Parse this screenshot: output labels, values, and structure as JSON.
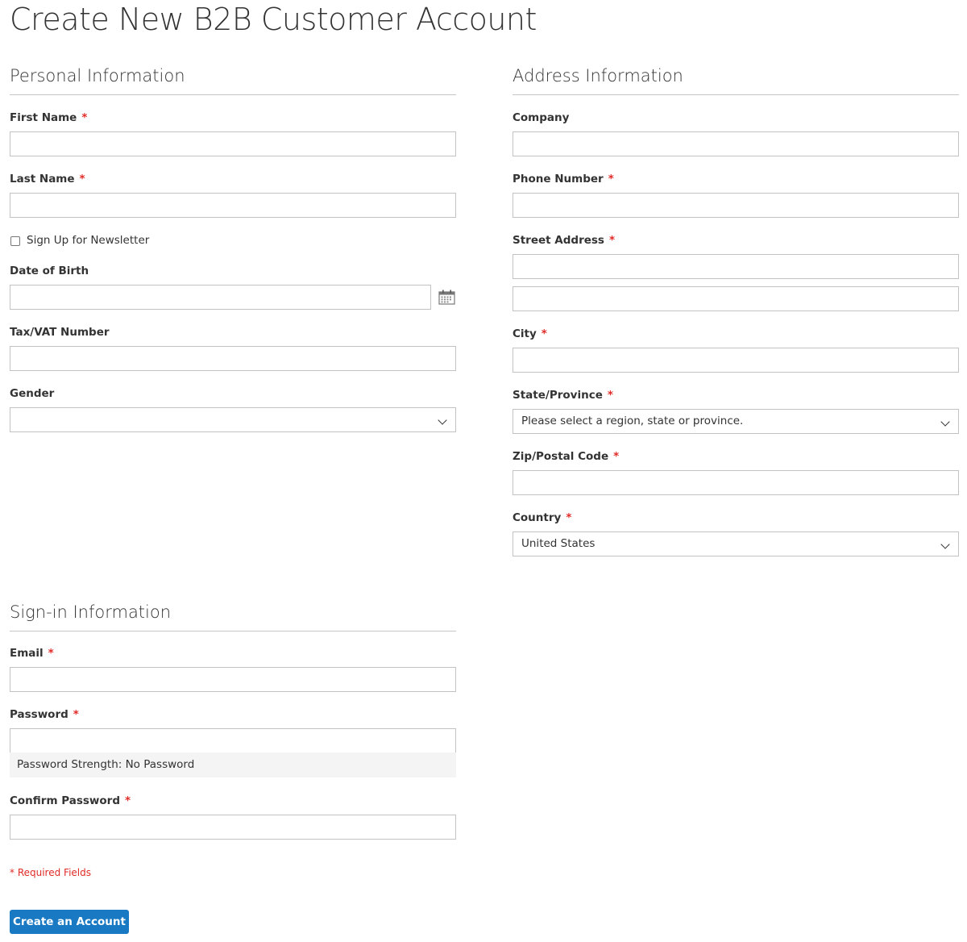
{
  "page": {
    "title": "Create New B2B Customer Account"
  },
  "personal": {
    "legend": "Personal Information",
    "first_name_label": "First Name",
    "last_name_label": "Last Name",
    "newsletter_label": "Sign Up for Newsletter",
    "dob_label": "Date of Birth",
    "taxvat_label": "Tax/VAT Number",
    "gender_label": "Gender",
    "gender_value": ""
  },
  "address": {
    "legend": "Address Information",
    "company_label": "Company",
    "phone_label": "Phone Number",
    "street_label": "Street Address",
    "city_label": "City",
    "state_label": "State/Province",
    "state_value": "Please select a region, state or province.",
    "zip_label": "Zip/Postal Code",
    "country_label": "Country",
    "country_value": "United States"
  },
  "signin": {
    "legend": "Sign-in Information",
    "email_label": "Email",
    "password_label": "Password",
    "password_strength": "Password Strength: No Password",
    "confirm_label": "Confirm Password"
  },
  "form": {
    "required_asterisk": "*",
    "required_note": "* Required Fields",
    "submit_label": "Create an Account"
  },
  "colors": {
    "accent": "#1979c3",
    "required": "#e02b27",
    "border": "#c2c2c2"
  },
  "icons": {
    "calendar": "calendar-icon",
    "chevron": "chevron-down-icon"
  }
}
